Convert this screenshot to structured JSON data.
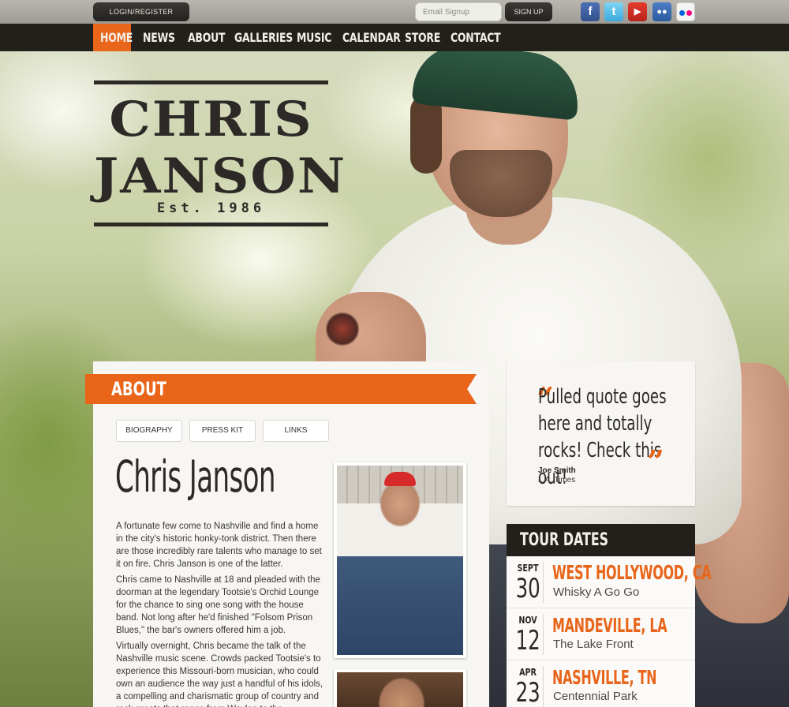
{
  "topbar": {
    "login_label": "LOGIN/REGISTER",
    "email_placeholder": "Email Signup",
    "signup_label": "SIGN UP",
    "social_icons": [
      "facebook-icon",
      "twitter-icon",
      "youtube-icon",
      "myspace-icon",
      "flickr-icon"
    ]
  },
  "nav": {
    "items": [
      "HOME",
      "NEWS",
      "ABOUT",
      "GALLERIES",
      "MUSIC",
      "CALENDAR",
      "STORE",
      "CONTACT"
    ],
    "active": "HOME",
    "accent_color": "#e8651a"
  },
  "logo": {
    "line1": "CHRIS",
    "line2": "JANSON",
    "tagline": "Est. 1986"
  },
  "about": {
    "section_title": "ABOUT",
    "tabs": [
      "BIOGRAPHY",
      "PRESS KIT",
      "LINKS"
    ],
    "name": "Chris Janson",
    "paragraphs": [
      "A fortunate few come to Nashville and find a home in the city's historic honky-tonk district. Then there are those incredibly rare talents who manage to set it on fire. Chris Janson is one of the latter.",
      "Chris came to Nashville at 18 and pleaded with the doorman at the legendary Tootsie's Orchid Lounge for the chance to sing one song with the house band. Not long after he'd finished \"Folsom Prison Blues,\" the bar's owners offered him a job.",
      "Virtually overnight, Chris became the talk of the Nashville music scene. Crowds packed Tootsie's to experience this Missouri-born musician, who could own an audience the way just a handful of his idols, a compelling and charismatic group of country and rock greats that range from Waylon to the Ramones, could"
    ]
  },
  "quote": {
    "text": "Pulled quote goes here and totally rocks! Check this out!",
    "author": "Joe Smith",
    "source": "L.A. Times"
  },
  "tour": {
    "title": "TOUR DATES",
    "dates": [
      {
        "month": "SEPT",
        "day": "30",
        "city": "WEST HOLLYWOOD, CA",
        "venue": "Whisky A Go Go"
      },
      {
        "month": "NOV",
        "day": "12",
        "city": "MANDEVILLE, LA",
        "venue": "The Lake Front"
      },
      {
        "month": "APR",
        "day": "23",
        "city": "NASHVILLE, TN",
        "venue": "Centennial Park"
      }
    ]
  }
}
